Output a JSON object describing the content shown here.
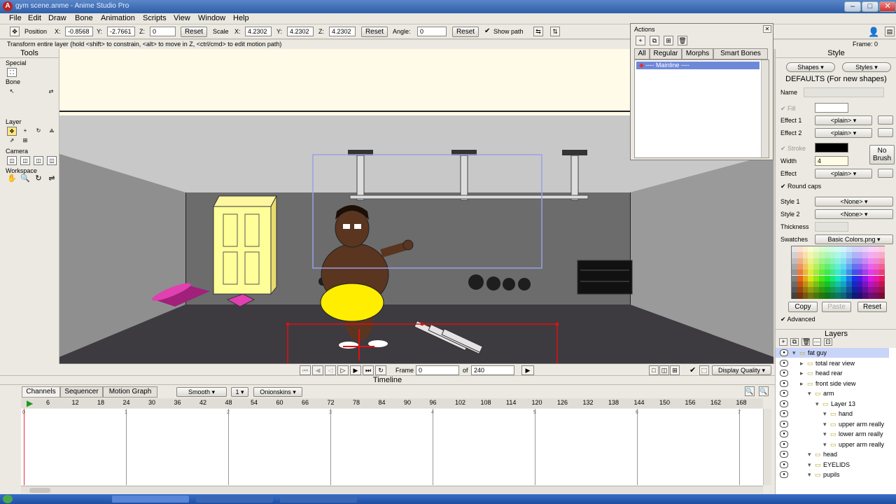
{
  "window": {
    "title": "gym scene.anme - Anime Studio Pro",
    "icon": "anime-studio-icon",
    "controls": [
      "minimize-icon",
      "maximize-icon",
      "close-icon"
    ]
  },
  "menu": [
    "File",
    "Edit",
    "Draw",
    "Bone",
    "Animation",
    "Scripts",
    "View",
    "Window",
    "Help"
  ],
  "tool_options": {
    "position_label": "Position",
    "x_label": "X:",
    "y_label": "Y:",
    "z_label": "Z:",
    "pos_x": "-0.8568",
    "pos_y": "-2.7661",
    "pos_z": "0",
    "reset": "Reset",
    "scale_label": "Scale",
    "scale_x": "4.2302",
    "scale_y": "4.2302",
    "scale_z": "4.2302",
    "angle_label": "Angle:",
    "angle": "0",
    "show_path": "Show path"
  },
  "frame_label": "Frame: 0",
  "hint": "Transform entire layer (hold <shift> to constrain, <alt> to move in Z, <ctrl/cmd> to edit motion path)",
  "tools": {
    "title": "Tools",
    "sections": [
      "Special",
      "Bone",
      "Layer",
      "Camera",
      "Workspace"
    ]
  },
  "actions": {
    "title": "Actions",
    "tabs": [
      "All",
      "Regular",
      "Morphs",
      "Smart Bones"
    ],
    "items": [
      "---- Mainline ----"
    ]
  },
  "style": {
    "title": "Style",
    "shapes_btn": "Shapes",
    "styles_btn": "Styles",
    "defaults": "DEFAULTS (For new shapes)",
    "name_label": "Name",
    "fill_label": "Fill",
    "effect1_label": "Effect 1",
    "effect2_label": "Effect 2",
    "plain": "<plain>",
    "stroke_label": "Stroke",
    "no_brush": "No Brush",
    "width_label": "Width",
    "width_value": "4",
    "effect_label": "Effect",
    "round_caps": "Round caps",
    "style1_label": "Style 1",
    "style2_label": "Style 2",
    "none": "<None>",
    "thickness_label": "Thickness",
    "swatches_label": "Swatches",
    "swatches_value": "Basic Colors.png",
    "copy": "Copy",
    "paste": "Paste",
    "reset": "Reset",
    "advanced": "Advanced",
    "fill_color": "#ffffff",
    "stroke_color": "#000000"
  },
  "layers": {
    "title": "Layers",
    "items": [
      {
        "name": "fat guy",
        "indent": 0,
        "selected": true
      },
      {
        "name": "total rear view",
        "indent": 1
      },
      {
        "name": "head rear",
        "indent": 1
      },
      {
        "name": "front side view",
        "indent": 1
      },
      {
        "name": "arm",
        "indent": 2
      },
      {
        "name": "Layer 13",
        "indent": 3
      },
      {
        "name": "hand",
        "indent": 4
      },
      {
        "name": "upper arm really",
        "indent": 4
      },
      {
        "name": "lower arm really",
        "indent": 4
      },
      {
        "name": "upper arm really",
        "indent": 4
      },
      {
        "name": "head",
        "indent": 2
      },
      {
        "name": "EYELIDS",
        "indent": 2
      },
      {
        "name": "pupils",
        "indent": 2
      }
    ]
  },
  "controls": {
    "frame_label": "Frame",
    "frame_value": "0",
    "of_label": "of",
    "total_frames": "240",
    "display_quality": "Display Quality"
  },
  "timeline": {
    "title": "Timeline",
    "tabs": [
      "Channels",
      "Sequencer",
      "Motion Graph"
    ],
    "interp": "Smooth",
    "step": "1",
    "onionskins": "Onionskins",
    "ruler": [
      "6",
      "12",
      "18",
      "24",
      "30",
      "36",
      "42",
      "48",
      "54",
      "60",
      "66",
      "72",
      "78",
      "84",
      "90",
      "96",
      "102",
      "108",
      "114",
      "120",
      "126",
      "132",
      "138",
      "144",
      "150",
      "156",
      "162",
      "168"
    ],
    "seconds": [
      "0",
      "1",
      "2",
      "3",
      "4",
      "5",
      "6",
      "7"
    ]
  }
}
